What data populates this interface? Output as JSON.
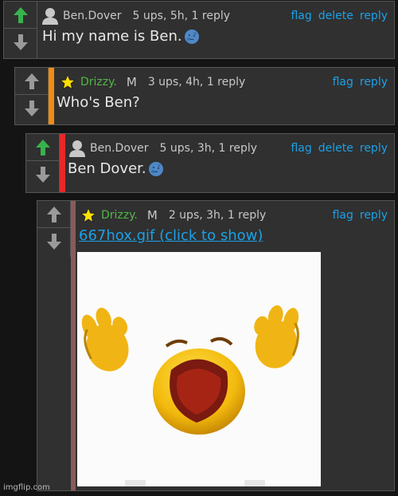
{
  "comments": [
    {
      "username": "Ben.Dover",
      "meta": "5 ups, 5h, 1 reply",
      "actions": [
        "flag",
        "delete",
        "reply"
      ],
      "body": "Hi my name is Ben.",
      "upvoted": true
    },
    {
      "username": "Drizzy.",
      "badge": "M",
      "meta": "3 ups, 4h, 1 reply",
      "actions": [
        "flag",
        "reply"
      ],
      "body": "Who's Ben?",
      "accent_color": "#f08c12"
    },
    {
      "username": "Ben.Dover",
      "meta": "5 ups, 3h, 1 reply",
      "actions": [
        "flag",
        "delete",
        "reply"
      ],
      "body": "Ben Dover.",
      "upvoted": true,
      "accent_color": "#e8282a"
    },
    {
      "username": "Drizzy.",
      "badge": "M",
      "meta": "2 ups, 3h, 1 reply",
      "actions": [
        "flag",
        "reply"
      ],
      "body_link": "667hox.gif (click to show)",
      "accent_color": "#8a5a5a"
    }
  ],
  "watermark": "imgflip.com",
  "colors": {
    "background": "#141414",
    "card": "#303030",
    "link": "#1ba1e8",
    "upvote_active": "#37b24d",
    "mod_username": "#51b847"
  }
}
